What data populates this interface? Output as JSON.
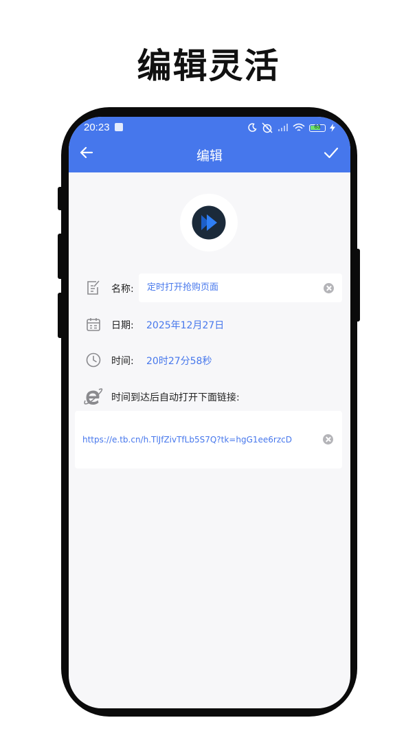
{
  "headline": "编辑灵活",
  "status_bar": {
    "time": "20:23",
    "battery": "63",
    "icons": [
      "wrench-icon",
      "moon-icon",
      "alarm-off-icon",
      "signal-icon",
      "wifi-icon",
      "battery-icon",
      "charging-icon"
    ]
  },
  "app_bar": {
    "title": "编辑",
    "back_icon": "arrow-left-icon",
    "confirm_icon": "check-icon"
  },
  "form": {
    "name_label": "名称:",
    "name_value": "定时打开抢购页面",
    "date_label": "日期:",
    "date_value": "2025年12月27日",
    "time_label": "时间:",
    "time_value": "20时27分58秒",
    "link_label": "时间到达后自动打开下面链接:",
    "link_value": "https://e.tb.cn/h.TlJfZivTfLb5S7Q?tk=hgG1ee6rzcD"
  },
  "colors": {
    "accent": "#4677ec",
    "background": "#f7f7f9",
    "icon_dark": "#1b2a3a",
    "icon_blue": "#2f7ff5"
  }
}
